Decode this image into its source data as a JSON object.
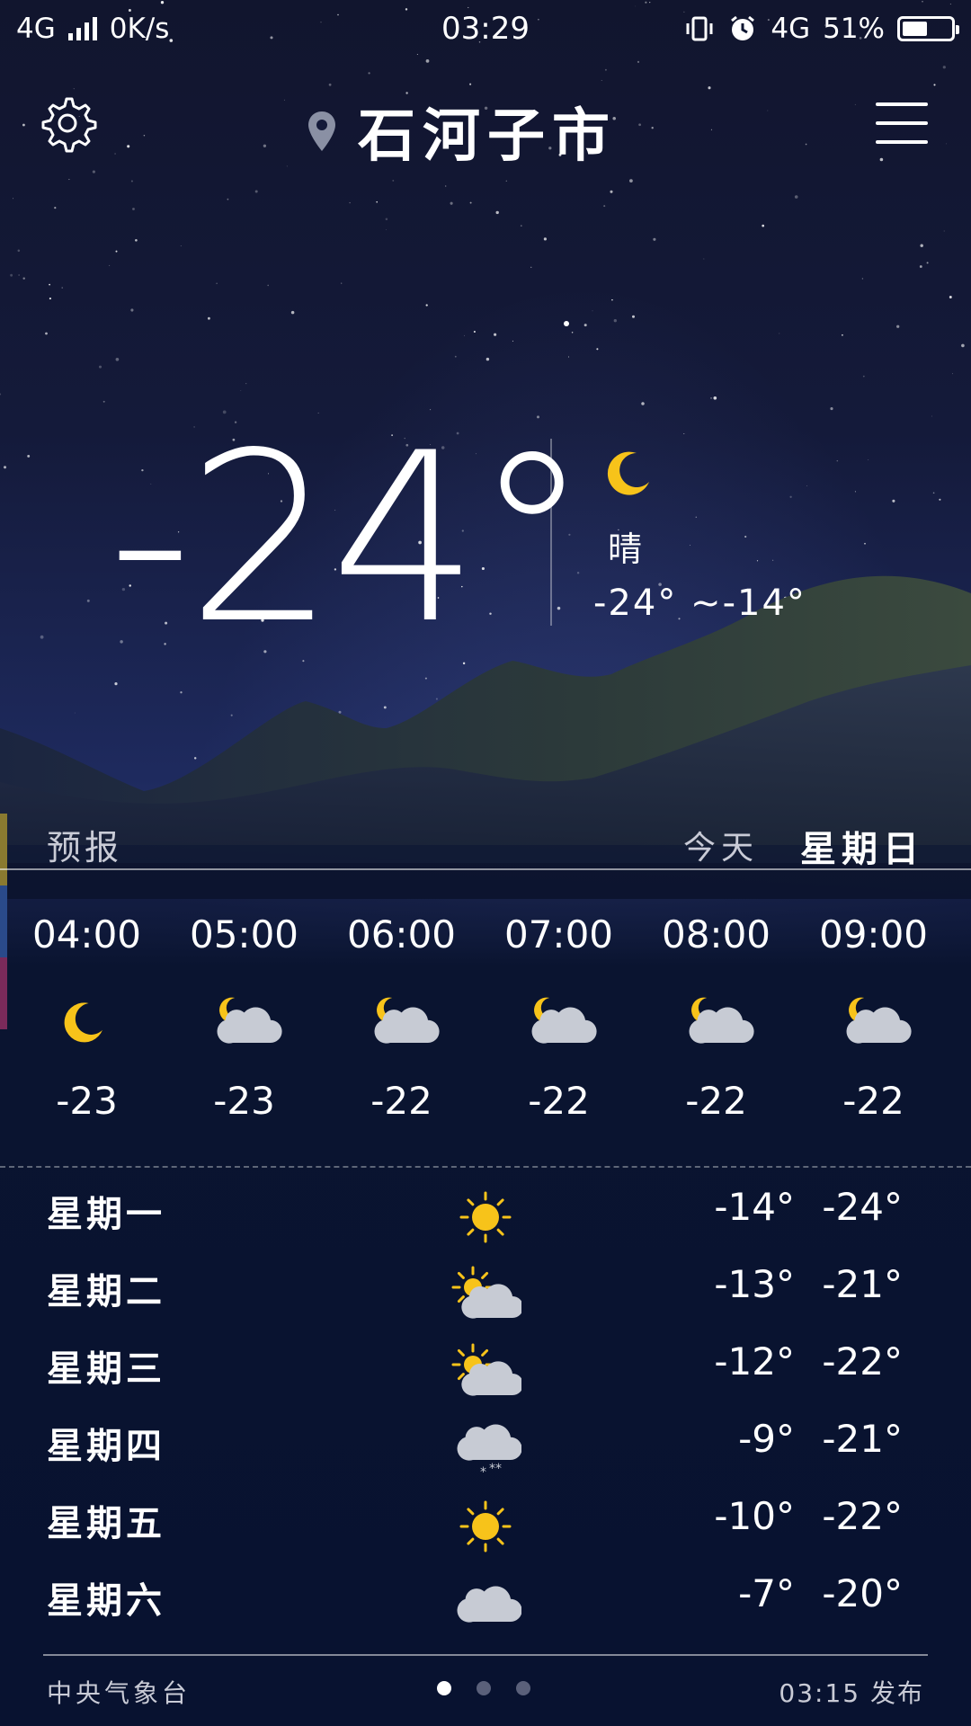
{
  "status_bar": {
    "network": "4G",
    "speed": "0K/s",
    "time": "03:29",
    "network_right": "4G",
    "battery": "51%",
    "battery_level": 0.51
  },
  "header": {
    "city": "石河子市"
  },
  "current": {
    "temperature": "-24°",
    "condition": "晴",
    "range": "-24°  ~-14°",
    "icon": "moon-icon"
  },
  "forecast_header": {
    "label": "预报",
    "today": "今天",
    "weekday": "星期日"
  },
  "hourly": [
    {
      "time": "04:00",
      "icon": "moon",
      "temp": "-23"
    },
    {
      "time": "05:00",
      "icon": "moon-cloud",
      "temp": "-23"
    },
    {
      "time": "06:00",
      "icon": "moon-cloud",
      "temp": "-22"
    },
    {
      "time": "07:00",
      "icon": "moon-cloud",
      "temp": "-22"
    },
    {
      "time": "08:00",
      "icon": "moon-cloud",
      "temp": "-22"
    },
    {
      "time": "09:00",
      "icon": "moon-cloud",
      "temp": "-22"
    }
  ],
  "daily": [
    {
      "day": "星期一",
      "icon": "sun",
      "high": "-14°",
      "low": "-24°"
    },
    {
      "day": "星期二",
      "icon": "sun-cloud",
      "high": "-13°",
      "low": "-21°"
    },
    {
      "day": "星期三",
      "icon": "sun-cloud",
      "high": "-12°",
      "low": "-22°"
    },
    {
      "day": "星期四",
      "icon": "snow",
      "high": "-9°",
      "low": "-21°"
    },
    {
      "day": "星期五",
      "icon": "sun",
      "high": "-10°",
      "low": "-22°"
    },
    {
      "day": "星期六",
      "icon": "cloud",
      "high": "-7°",
      "low": "-20°"
    }
  ],
  "footer": {
    "source": "中央气象台",
    "published": "03:15 发布",
    "page_count": 3,
    "active_page": 0
  },
  "colors": {
    "sun": "#f7c31a",
    "moon": "#f7c31a",
    "cloud": "#c7cbd4"
  }
}
